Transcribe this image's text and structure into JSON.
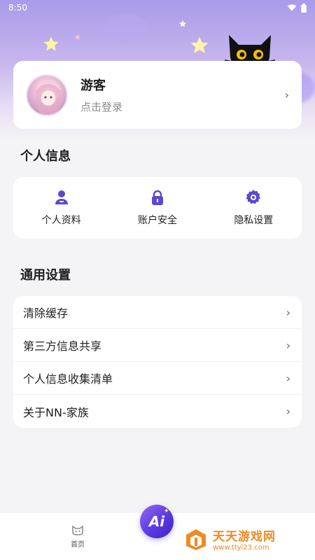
{
  "status_bar": {
    "time": "8:50"
  },
  "profile": {
    "name": "游客",
    "subtitle": "点击登录"
  },
  "personal_section": {
    "title": "个人信息",
    "items": [
      {
        "label": "个人资料",
        "icon": "person-icon"
      },
      {
        "label": "账户安全",
        "icon": "lock-icon"
      },
      {
        "label": "隐私设置",
        "icon": "gear-icon"
      }
    ]
  },
  "general_section": {
    "title": "通用设置",
    "items": [
      {
        "label": "清除缓存"
      },
      {
        "label": "第三方信息共享"
      },
      {
        "label": "个人信息收集清单"
      },
      {
        "label": "关于NN-家族"
      }
    ]
  },
  "tabbar": {
    "home_label": "首页",
    "ai_label": "Ai"
  },
  "watermark": {
    "title": "天天游戏网",
    "url": "www.ttyl23.com"
  },
  "colors": {
    "accent": "#5b4ad6",
    "icon_purple": "#5a48d0",
    "watermark": "#f08a24"
  }
}
